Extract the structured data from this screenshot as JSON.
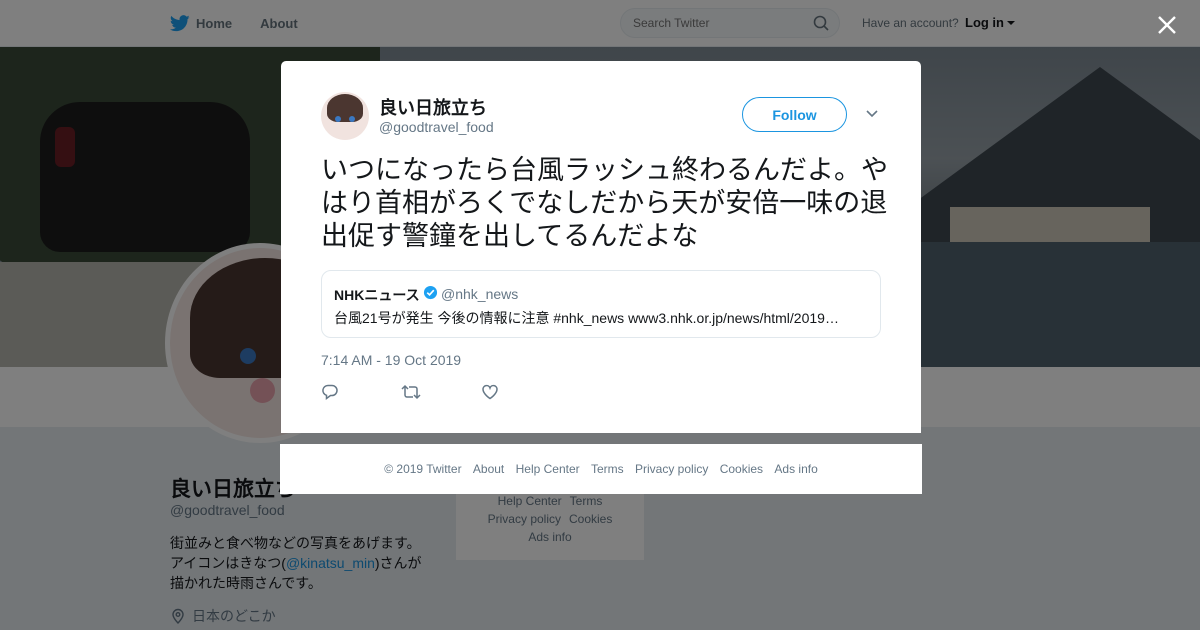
{
  "nav": {
    "home_label": "Home",
    "about_label": "About",
    "search_placeholder": "Search Twitter",
    "have_account": "Have an account?",
    "login_label": "Log in",
    "brand_color": "#1da1f2"
  },
  "profile": {
    "name": "良い日旅立ち",
    "handle": "@goodtravel_food",
    "bio_line1": "街並みと食べ物などの写真をあげます。",
    "bio_line2_pre": "アイコンはきなつ(",
    "bio_mention": "@kinatsu_min",
    "bio_line2_post": ")さんが",
    "bio_line3": "描かれた時雨さんです。",
    "location": "日本のどこか"
  },
  "mini_footer": {
    "help_center": "Help Center",
    "terms": "Terms",
    "privacy": "Privacy policy",
    "cookies": "Cookies",
    "ads_info": "Ads info"
  },
  "tweet": {
    "author_name": "良い日旅立ち",
    "author_handle": "@goodtravel_food",
    "follow_label": "Follow",
    "text": "いつになったら台風ラッシュ終わるんだよ。やはり首相がろくでなしだから天が安倍一味の退出促す警鐘を出してるんだよな",
    "timestamp": "7:14 AM - 19 Oct 2019",
    "quoted": {
      "name": "NHKニュース",
      "handle": "@nhk_news",
      "text": "台風21号が発生 今後の情報に注意 #nhk_news www3.nhk.or.jp/news/html/2019…"
    },
    "actions": [
      "reply-icon",
      "retweet-icon",
      "like-icon"
    ]
  },
  "footer": {
    "copyright": "© 2019 Twitter",
    "about": "About",
    "help_center": "Help Center",
    "terms": "Terms",
    "privacy": "Privacy policy",
    "cookies": "Cookies",
    "ads_info": "Ads info"
  }
}
